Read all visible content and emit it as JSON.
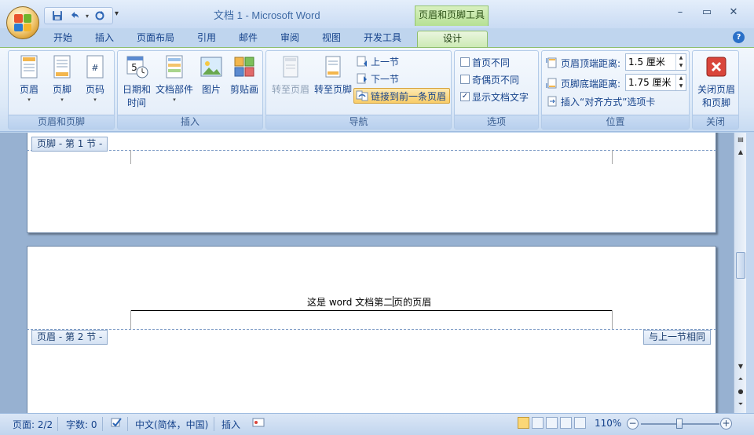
{
  "titlebar": {
    "title": "文档 1 - Microsoft Word",
    "context_tab": "页眉和页脚工具",
    "qat_more": "▾",
    "minimize": "–",
    "maximize": "▭",
    "close": "✕"
  },
  "tabs": [
    {
      "label": "开始"
    },
    {
      "label": "插入"
    },
    {
      "label": "页面布局"
    },
    {
      "label": "引用"
    },
    {
      "label": "邮件"
    },
    {
      "label": "审阅"
    },
    {
      "label": "视图"
    },
    {
      "label": "开发工具"
    },
    {
      "label": "设计",
      "active": true
    }
  ],
  "help": "?",
  "ribbon": {
    "hf_group": {
      "label": "页眉和页脚",
      "header": "页眉",
      "footer": "页脚",
      "page_number": "页码"
    },
    "insert_group": {
      "label": "插入",
      "datetime_line1": "日期和",
      "datetime_line2": "时间",
      "quick_parts": "文档部件",
      "picture": "图片",
      "clipart": "剪贴画"
    },
    "nav_group": {
      "label": "导航",
      "goto_header": "转至页眉",
      "goto_footer": "转至页脚",
      "prev_section": "上一节",
      "next_section": "下一节",
      "link_previous": "链接到前一条页眉"
    },
    "options_group": {
      "label": "选项",
      "different_first": "首页不同",
      "different_odd_even": "奇偶页不同",
      "show_doc_text": "显示文档文字",
      "show_doc_text_checked": "✓"
    },
    "position_group": {
      "label": "位置",
      "header_from_top": "页眉顶端距离:",
      "header_from_top_value": "1.5 厘米",
      "footer_from_bottom": "页脚底端距离:",
      "footer_from_bottom_value": "1.75 厘米",
      "insert_alignment_tab": "插入“对齐方式”选项卡"
    },
    "close_group": {
      "label": "关闭",
      "close_line1": "关闭页眉",
      "close_line2": "和页脚"
    }
  },
  "document": {
    "footer_tag": "页脚 - 第 1 节 -",
    "header_tag": "页眉 - 第 2 节 -",
    "same_as_previous": "与上一节相同",
    "header_text_before": "这是 word 文档第二",
    "header_text_after": "页的页眉"
  },
  "statusbar": {
    "page": "页面: 2/2",
    "words": "字数: 0",
    "language": "中文(简体，中国)",
    "insert_mode": "插入",
    "zoom": "110%",
    "zoom_out": "−",
    "zoom_in": "+"
  },
  "colors": {
    "ribbon_bg": "#dbe8f7",
    "context_green": "#b6e094",
    "doc_bg": "#97b1d1",
    "highlight": "#f9cd68"
  }
}
